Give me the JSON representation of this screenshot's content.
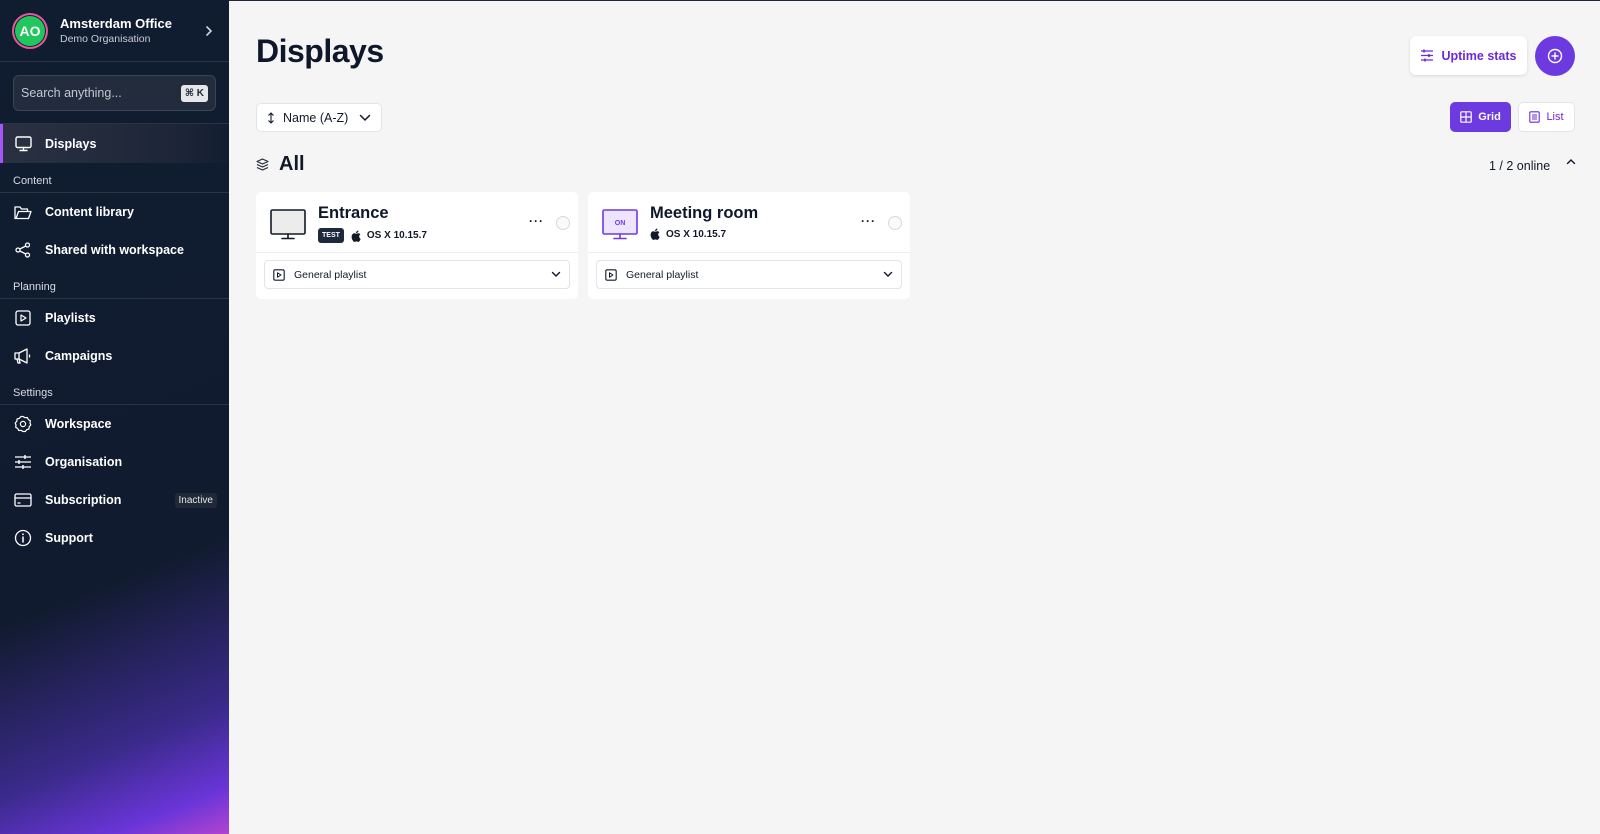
{
  "sidebar": {
    "org": {
      "initials": "AO",
      "name": "Amsterdam Office",
      "subtitle": "Demo Organisation"
    },
    "search": {
      "placeholder": "Search anything...",
      "shortcut": "⌘ K"
    },
    "primary": {
      "label": "Displays",
      "icon": "monitor-icon"
    },
    "sections": [
      {
        "label": "Content",
        "items": [
          {
            "label": "Content library",
            "icon": "folder-icon"
          },
          {
            "label": "Shared with workspace",
            "icon": "share-icon"
          }
        ]
      },
      {
        "label": "Planning",
        "items": [
          {
            "label": "Playlists",
            "icon": "playlist-icon"
          },
          {
            "label": "Campaigns",
            "icon": "megaphone-icon"
          }
        ]
      },
      {
        "label": "Settings",
        "items": [
          {
            "label": "Workspace",
            "icon": "gear-icon"
          },
          {
            "label": "Organisation",
            "icon": "sliders-icon"
          },
          {
            "label": "Subscription",
            "icon": "card-icon",
            "badge": "Inactive"
          },
          {
            "label": "Support",
            "icon": "info-icon"
          }
        ]
      }
    ]
  },
  "header": {
    "title": "Displays",
    "uptime_label": "Uptime stats",
    "sort_label": "Name (A-Z)",
    "view": {
      "grid_label": "Grid",
      "list_label": "List",
      "selected": "Grid"
    }
  },
  "group": {
    "title": "All",
    "online_status": "1 / 2 online"
  },
  "displays": [
    {
      "name": "Entrance",
      "badge": "TEST",
      "os": "OS X 10.15.7",
      "playlist": "General playlist",
      "status": "offline"
    },
    {
      "name": "Meeting room",
      "os": "OS X 10.15.7",
      "playlist": "General playlist",
      "status": "online",
      "screen_label": "ON"
    }
  ],
  "colors": {
    "accent": "#6d3ae0",
    "sidebar_bg": "#101c30",
    "avatar_green": "#22c55e",
    "online_screen": "#ede4ff"
  }
}
